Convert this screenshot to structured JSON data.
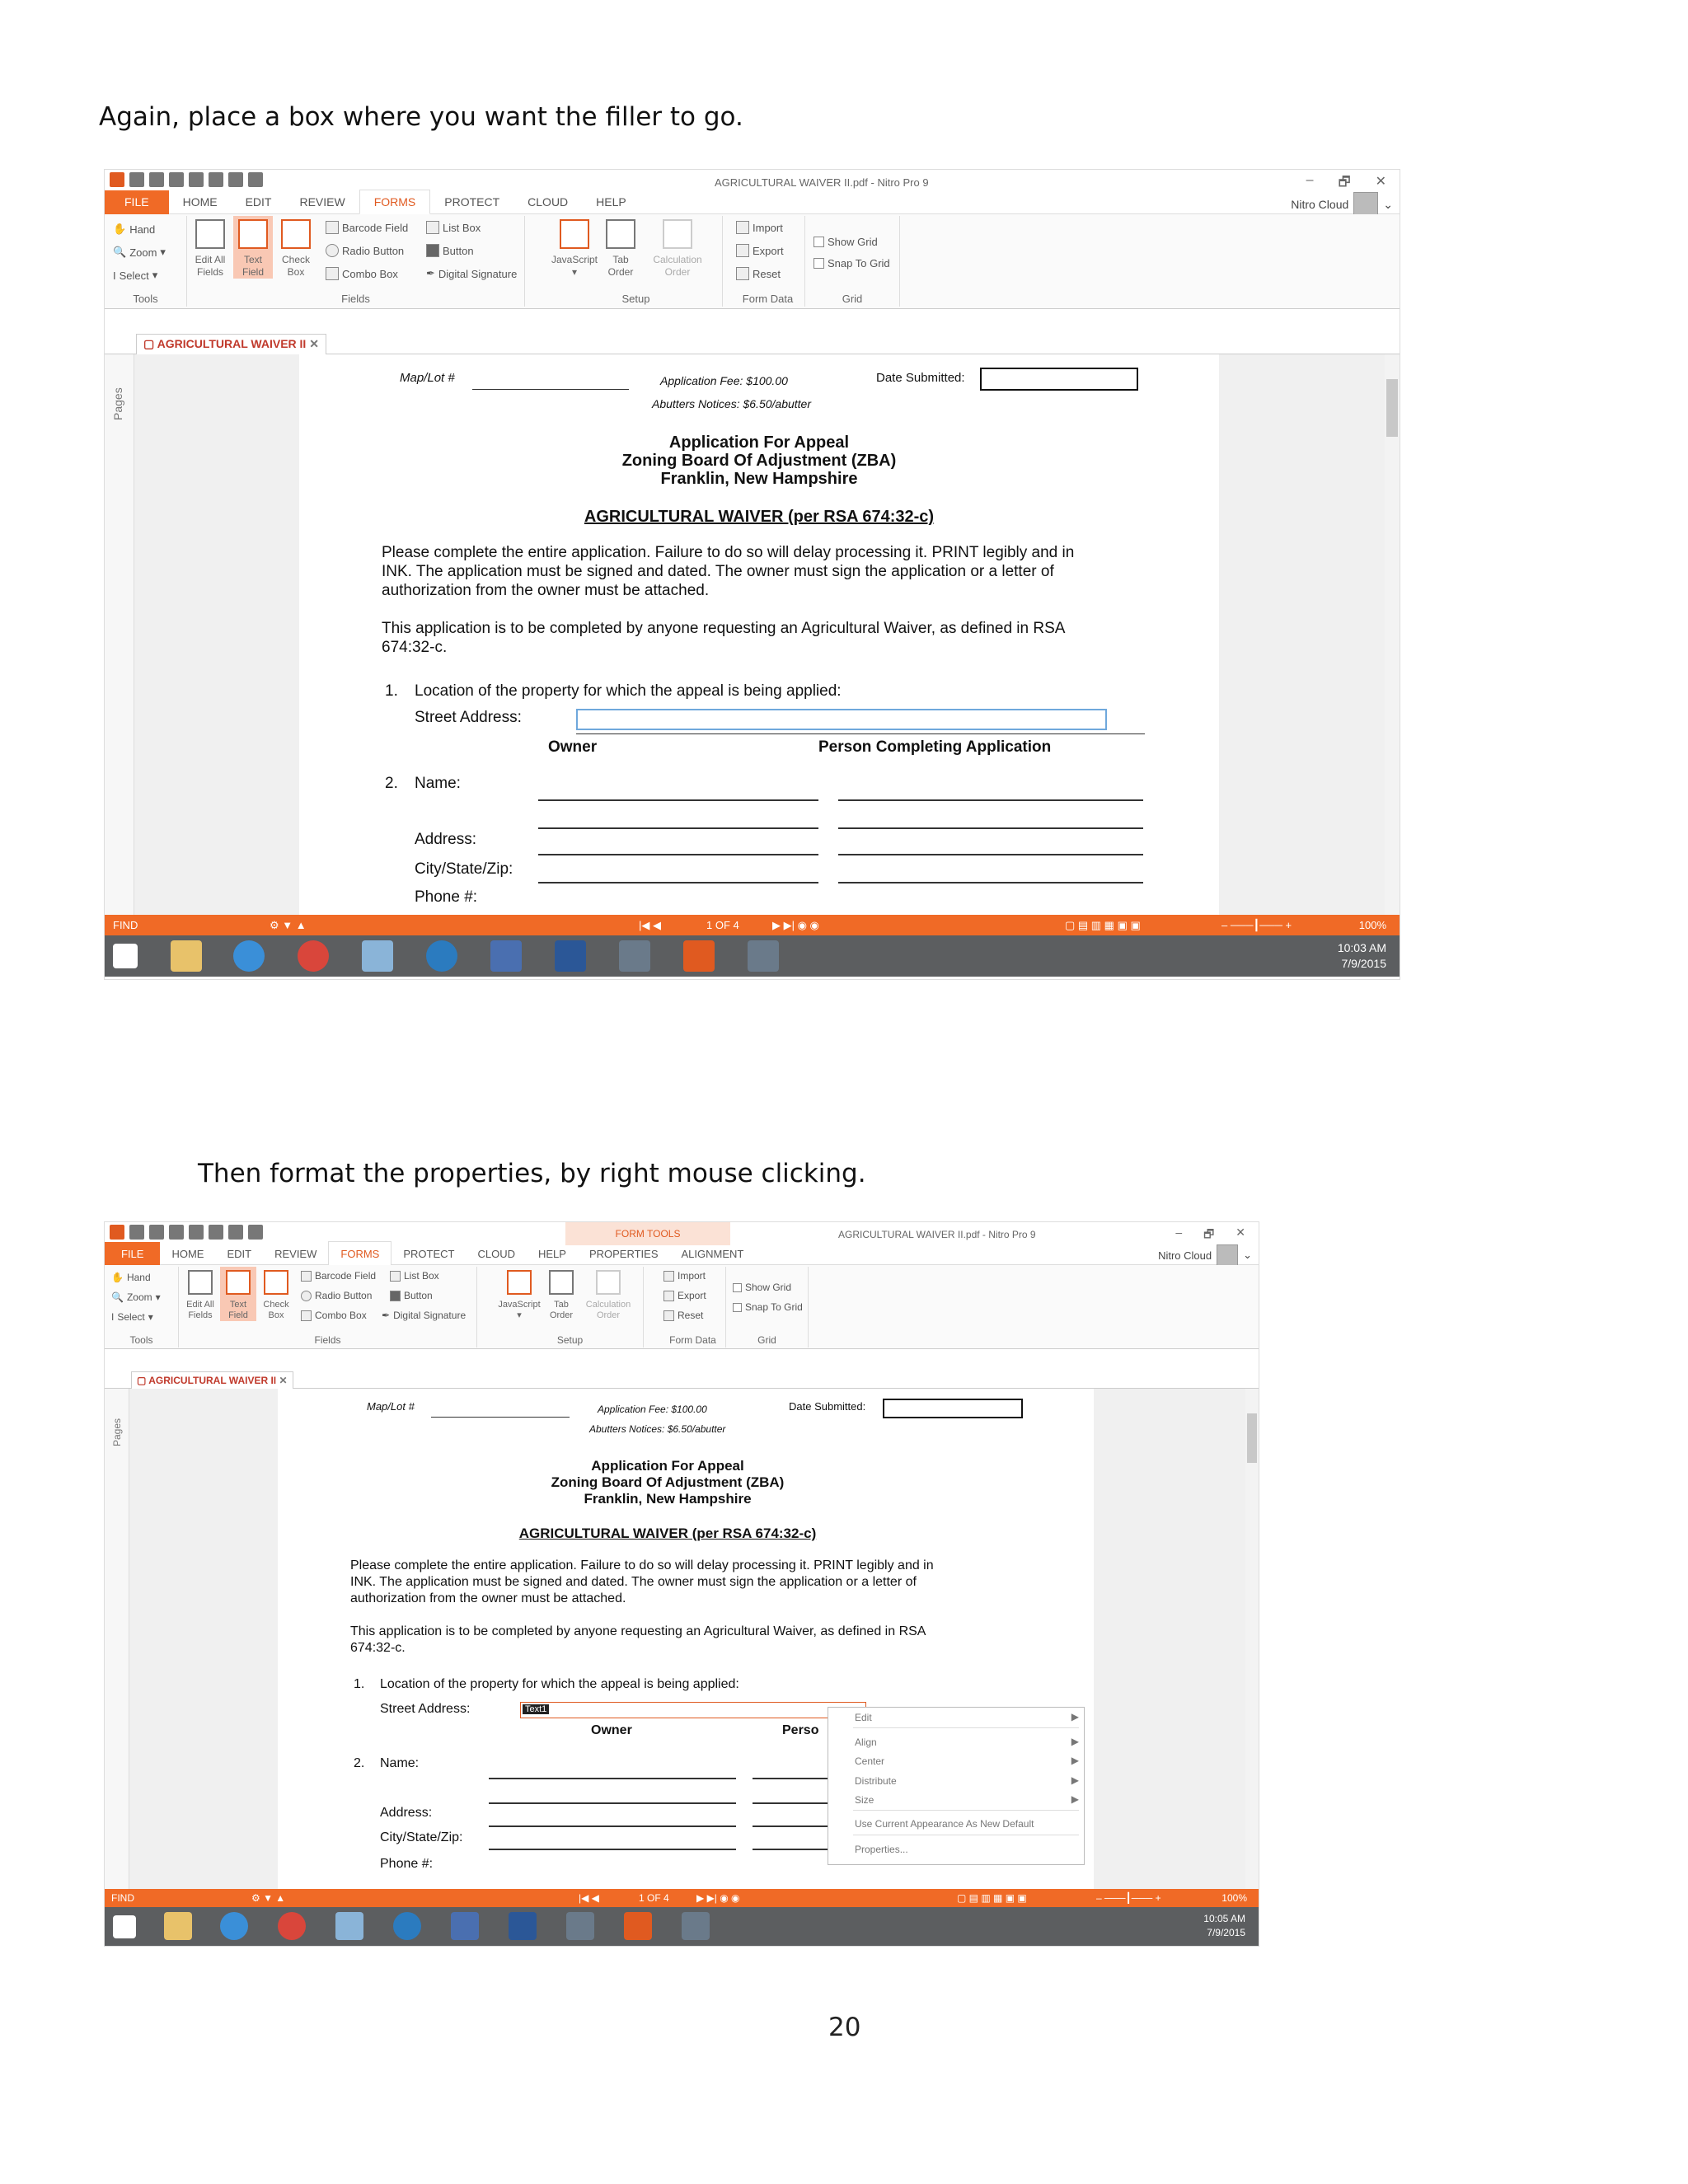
{
  "captions": {
    "first": "Again, place a box where you want the filler to go.",
    "second": "Then format the properties, by right mouse clicking."
  },
  "page_number": "20",
  "app": {
    "title": "AGRICULTURAL WAIVER II.pdf - Nitro Pro 9",
    "menu": [
      "FILE",
      "HOME",
      "EDIT",
      "REVIEW",
      "FORMS",
      "PROTECT",
      "CLOUD",
      "HELP"
    ],
    "menu_extra": [
      "PROPERTIES",
      "ALIGNMENT"
    ],
    "form_tools": "FORM TOOLS",
    "account": "Nitro Cloud",
    "window_controls": [
      "–",
      "🗗",
      "✕"
    ],
    "tools": {
      "hand": "Hand",
      "zoom": "Zoom",
      "select": "Select",
      "label": "Tools"
    },
    "fields": {
      "edit_all": "Edit All Fields",
      "text_field": "Text Field",
      "check_box": "Check Box",
      "barcode": "Barcode Field",
      "list_box": "List Box",
      "radio": "Radio Button",
      "button": "Button",
      "combo": "Combo Box",
      "digsig": "Digital Signature",
      "label": "Fields"
    },
    "setup": {
      "javascript": "JavaScript",
      "tab_order": "Tab Order",
      "calc_order": "Calculation Order",
      "label": "Setup"
    },
    "form_data": {
      "import": "Import",
      "export": "Export",
      "reset": "Reset",
      "label": "Form Data"
    },
    "grid": {
      "show": "Show Grid",
      "snap": "Snap To Grid",
      "label": "Grid"
    },
    "doc_tab": "AGRICULTURAL WAIVER II",
    "pages_label": "Pages",
    "status": {
      "find": "FIND",
      "page": "1 OF 4",
      "zoom": "100%"
    },
    "clock1": {
      "time": "10:03 AM",
      "date": "7/9/2015"
    },
    "clock2": {
      "time": "10:05 AM",
      "date": "7/9/2015"
    }
  },
  "document": {
    "map_lot": "Map/Lot #",
    "fee": "Application Fee:  $100.00",
    "date_submitted": "Date Submitted:",
    "abutters": "Abutters Notices: $6.50/abutter",
    "h1": "Application For Appeal",
    "h2": "Zoning Board Of Adjustment (ZBA)",
    "h3": "Franklin, New Hampshire",
    "h4": "AGRICULTURAL WAIVER (per RSA 674:32-c)",
    "p1": [
      "Please complete the entire application.  Failure to do so will delay processing it.  PRINT legibly and in",
      "INK.  The application must be signed and dated.  The owner must sign the application or a letter of",
      "authorization from the owner must be attached."
    ],
    "p2": [
      "This application is to be completed by anyone requesting an Agricultural Waiver, as defined in RSA",
      "674:32-c."
    ],
    "item1_num": "1.",
    "item1": "Location of the property for which the appeal is being applied:",
    "street": "Street Address:",
    "owner": "Owner",
    "person": "Person Completing Application",
    "person_cut": "Perso",
    "item2_num": "2.",
    "name": "Name:",
    "address": "Address:",
    "city": "City/State/Zip:",
    "phone": "Phone #:",
    "text1": "Text1"
  },
  "context_menu": [
    "Edit",
    "Align",
    "Center",
    "Distribute",
    "Size",
    "Use Current Appearance As New Default",
    "Properties..."
  ]
}
